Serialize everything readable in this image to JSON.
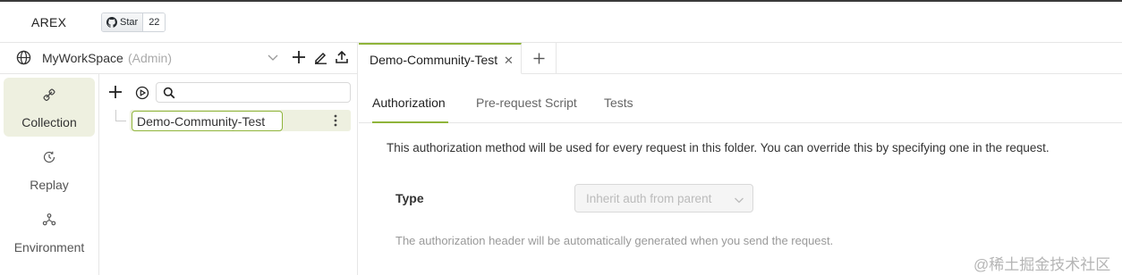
{
  "app": {
    "logo": "AREX"
  },
  "github": {
    "star_label": "Star",
    "star_count": "22"
  },
  "workspace": {
    "name": "MyWorkSpace",
    "role": "(Admin)"
  },
  "nav": {
    "items": [
      {
        "label": "Collection",
        "icon": "collection-icon",
        "active": true
      },
      {
        "label": "Replay",
        "icon": "replay-icon",
        "active": false
      },
      {
        "label": "Environment",
        "icon": "environment-icon",
        "active": false
      }
    ]
  },
  "tree": {
    "search_placeholder": "",
    "node_value": "Demo-Community-Test"
  },
  "tabs": [
    {
      "title": "Demo-Community-Test",
      "close": "✕"
    }
  ],
  "subtabs": [
    {
      "label": "Authorization",
      "active": true
    },
    {
      "label": "Pre-request Script",
      "active": false
    },
    {
      "label": "Tests",
      "active": false
    }
  ],
  "auth": {
    "description": "This authorization method will be used for every request in this folder. You can override this by specifying one in the request.",
    "type_label": "Type",
    "type_value": "Inherit auth from parent",
    "note": "The authorization header will be automatically generated when you send the request."
  },
  "watermark": "@稀土掘金技术社区",
  "colors": {
    "accent": "#8fb43a",
    "active_bg": "#eef0e0"
  }
}
